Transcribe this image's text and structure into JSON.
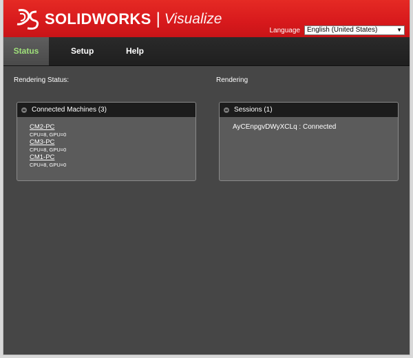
{
  "header": {
    "brand": "SOLIDWORKS",
    "separator": "|",
    "product": "Visualize",
    "language_label": "Language",
    "language_value": "English (United States)",
    "colors": {
      "header_red": "#d7191c",
      "active_tab_text": "#9fe07a"
    }
  },
  "nav": {
    "tabs": [
      {
        "label": "Status",
        "active": true
      },
      {
        "label": "Setup",
        "active": false
      },
      {
        "label": "Help",
        "active": false
      }
    ]
  },
  "main": {
    "left_label": "Rendering Status:",
    "right_label": "Rendering",
    "machines_panel": {
      "title": "Connected Machines (3)",
      "machines": [
        {
          "name": "CM2-PC",
          "info": "CPU=8, GPU=0"
        },
        {
          "name": "CM3-PC",
          "info": "CPU=8, GPU=0"
        },
        {
          "name": "CM1-PC",
          "info": "CPU=8, GPU=0"
        }
      ]
    },
    "sessions_panel": {
      "title": "Sessions (1)",
      "sessions": [
        {
          "text": "AyCEnpgvDWyXCLq : Connected"
        }
      ]
    }
  }
}
